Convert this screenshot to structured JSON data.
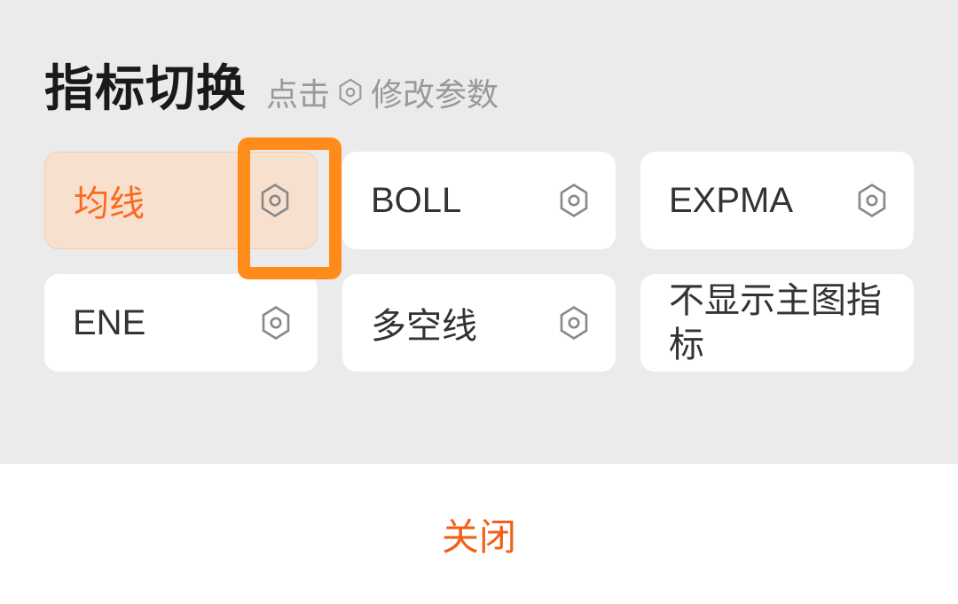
{
  "header": {
    "title": "指标切换",
    "subtitle_prefix": "点击",
    "subtitle_suffix": "修改参数"
  },
  "indicators": [
    {
      "label": "均线",
      "selected": true,
      "has_gear": true
    },
    {
      "label": "BOLL",
      "selected": false,
      "has_gear": true
    },
    {
      "label": "EXPMA",
      "selected": false,
      "has_gear": true
    },
    {
      "label": "ENE",
      "selected": false,
      "has_gear": true
    },
    {
      "label": "多空线",
      "selected": false,
      "has_gear": true
    },
    {
      "label": "不显示主图指标",
      "selected": false,
      "has_gear": false
    }
  ],
  "footer": {
    "close_label": "关闭"
  }
}
